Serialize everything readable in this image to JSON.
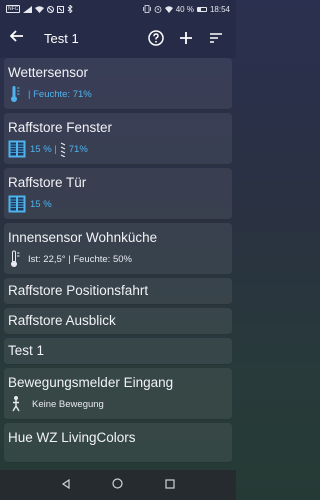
{
  "status": {
    "left_badge": "NFC",
    "battery": "40 %",
    "time": "18:54"
  },
  "appbar": {
    "title": "Test 1"
  },
  "cards": [
    {
      "name": "Wettersensor",
      "detail": "| Feuchte: 71%"
    },
    {
      "name": "Raffstore Fenster",
      "detail_a": "15 % |",
      "detail_b": "71%"
    },
    {
      "name": "Raffstore Tür",
      "detail": "15 %"
    },
    {
      "name": "Innensensor Wohnküche",
      "detail": "Ist: 22,5° | Feuchte: 50%"
    },
    {
      "name": "Raffstore Positionsfahrt"
    },
    {
      "name": "Raffstore Ausblick"
    },
    {
      "name": "Test 1"
    },
    {
      "name": "Bewegungsmelder Eingang",
      "detail": "Keine Bewegung"
    },
    {
      "name": "Hue WZ LivingColors"
    }
  ],
  "colors": {
    "accent": "#4fb3f0",
    "appbar": "#262b47"
  }
}
